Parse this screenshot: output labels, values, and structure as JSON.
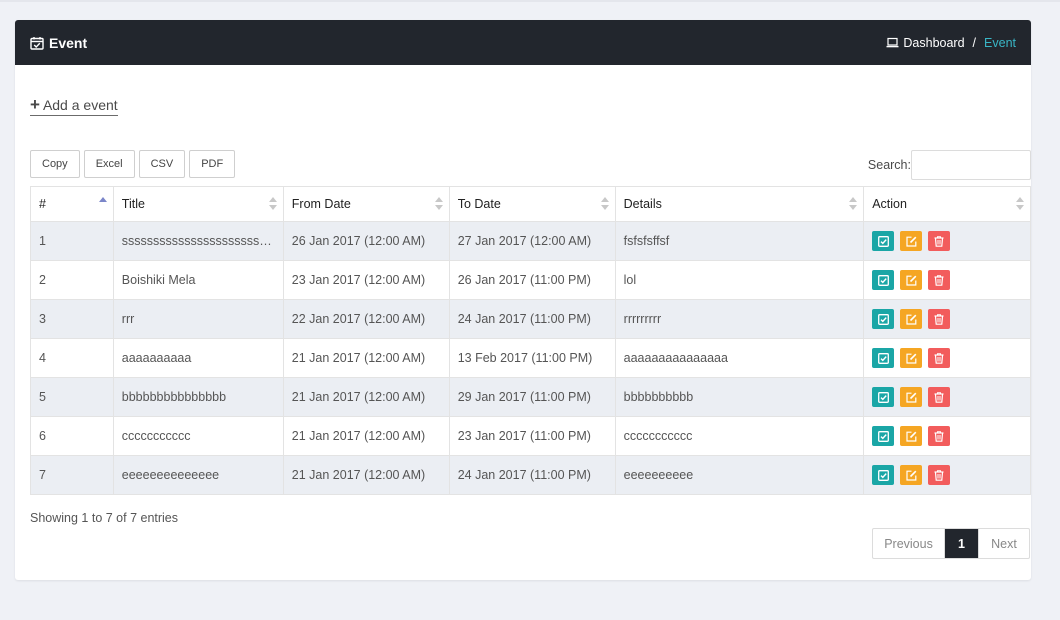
{
  "header": {
    "title": "Event",
    "breadcrumb": {
      "home": "Dashboard",
      "separator": "/",
      "current": "Event"
    }
  },
  "add_link": {
    "icon": "+",
    "label": "Add a event"
  },
  "export_buttons": [
    "Copy",
    "Excel",
    "CSV",
    "PDF"
  ],
  "search": {
    "label": "Search:",
    "value": "",
    "placeholder": ""
  },
  "table": {
    "columns": [
      "#",
      "Title",
      "From Date",
      "To Date",
      "Details",
      "Action"
    ],
    "rows": [
      {
        "no": "1",
        "title": "sssssssssssssssssssssssss...",
        "from": "26 Jan 2017 (12:00 AM)",
        "to": "27 Jan 2017 (12:00 AM)",
        "details": "fsfsfsffsf"
      },
      {
        "no": "2",
        "title": "Boishiki Mela",
        "from": "23 Jan 2017 (12:00 AM)",
        "to": "26 Jan 2017 (11:00 PM)",
        "details": "lol"
      },
      {
        "no": "3",
        "title": "rrr",
        "from": "22 Jan 2017 (12:00 AM)",
        "to": "24 Jan 2017 (11:00 PM)",
        "details": "rrrrrrrrr"
      },
      {
        "no": "4",
        "title": "aaaaaaaaaa",
        "from": "21 Jan 2017 (12:00 AM)",
        "to": "13 Feb 2017 (11:00 PM)",
        "details": "aaaaaaaaaaaaaaa"
      },
      {
        "no": "5",
        "title": "bbbbbbbbbbbbbbb",
        "from": "21 Jan 2017 (12:00 AM)",
        "to": "29 Jan 2017 (11:00 PM)",
        "details": "bbbbbbbbbb"
      },
      {
        "no": "6",
        "title": "ccccccccccc",
        "from": "21 Jan 2017 (12:00 AM)",
        "to": "23 Jan 2017 (11:00 PM)",
        "details": "ccccccccccc"
      },
      {
        "no": "7",
        "title": "eeeeeeeeeeeeee",
        "from": "21 Jan 2017 (12:00 AM)",
        "to": "24 Jan 2017 (11:00 PM)",
        "details": "eeeeeeeeee"
      }
    ]
  },
  "footer": {
    "info": "Showing 1 to 7 of 7 entries",
    "pagination": {
      "previous": "Previous",
      "current": "1",
      "next": "Next"
    }
  },
  "colors": {
    "header_bg": "#22262d",
    "accent": "#39b6c6",
    "view": "#1aa6a6",
    "edit": "#f5a623",
    "delete": "#f25c5c"
  }
}
